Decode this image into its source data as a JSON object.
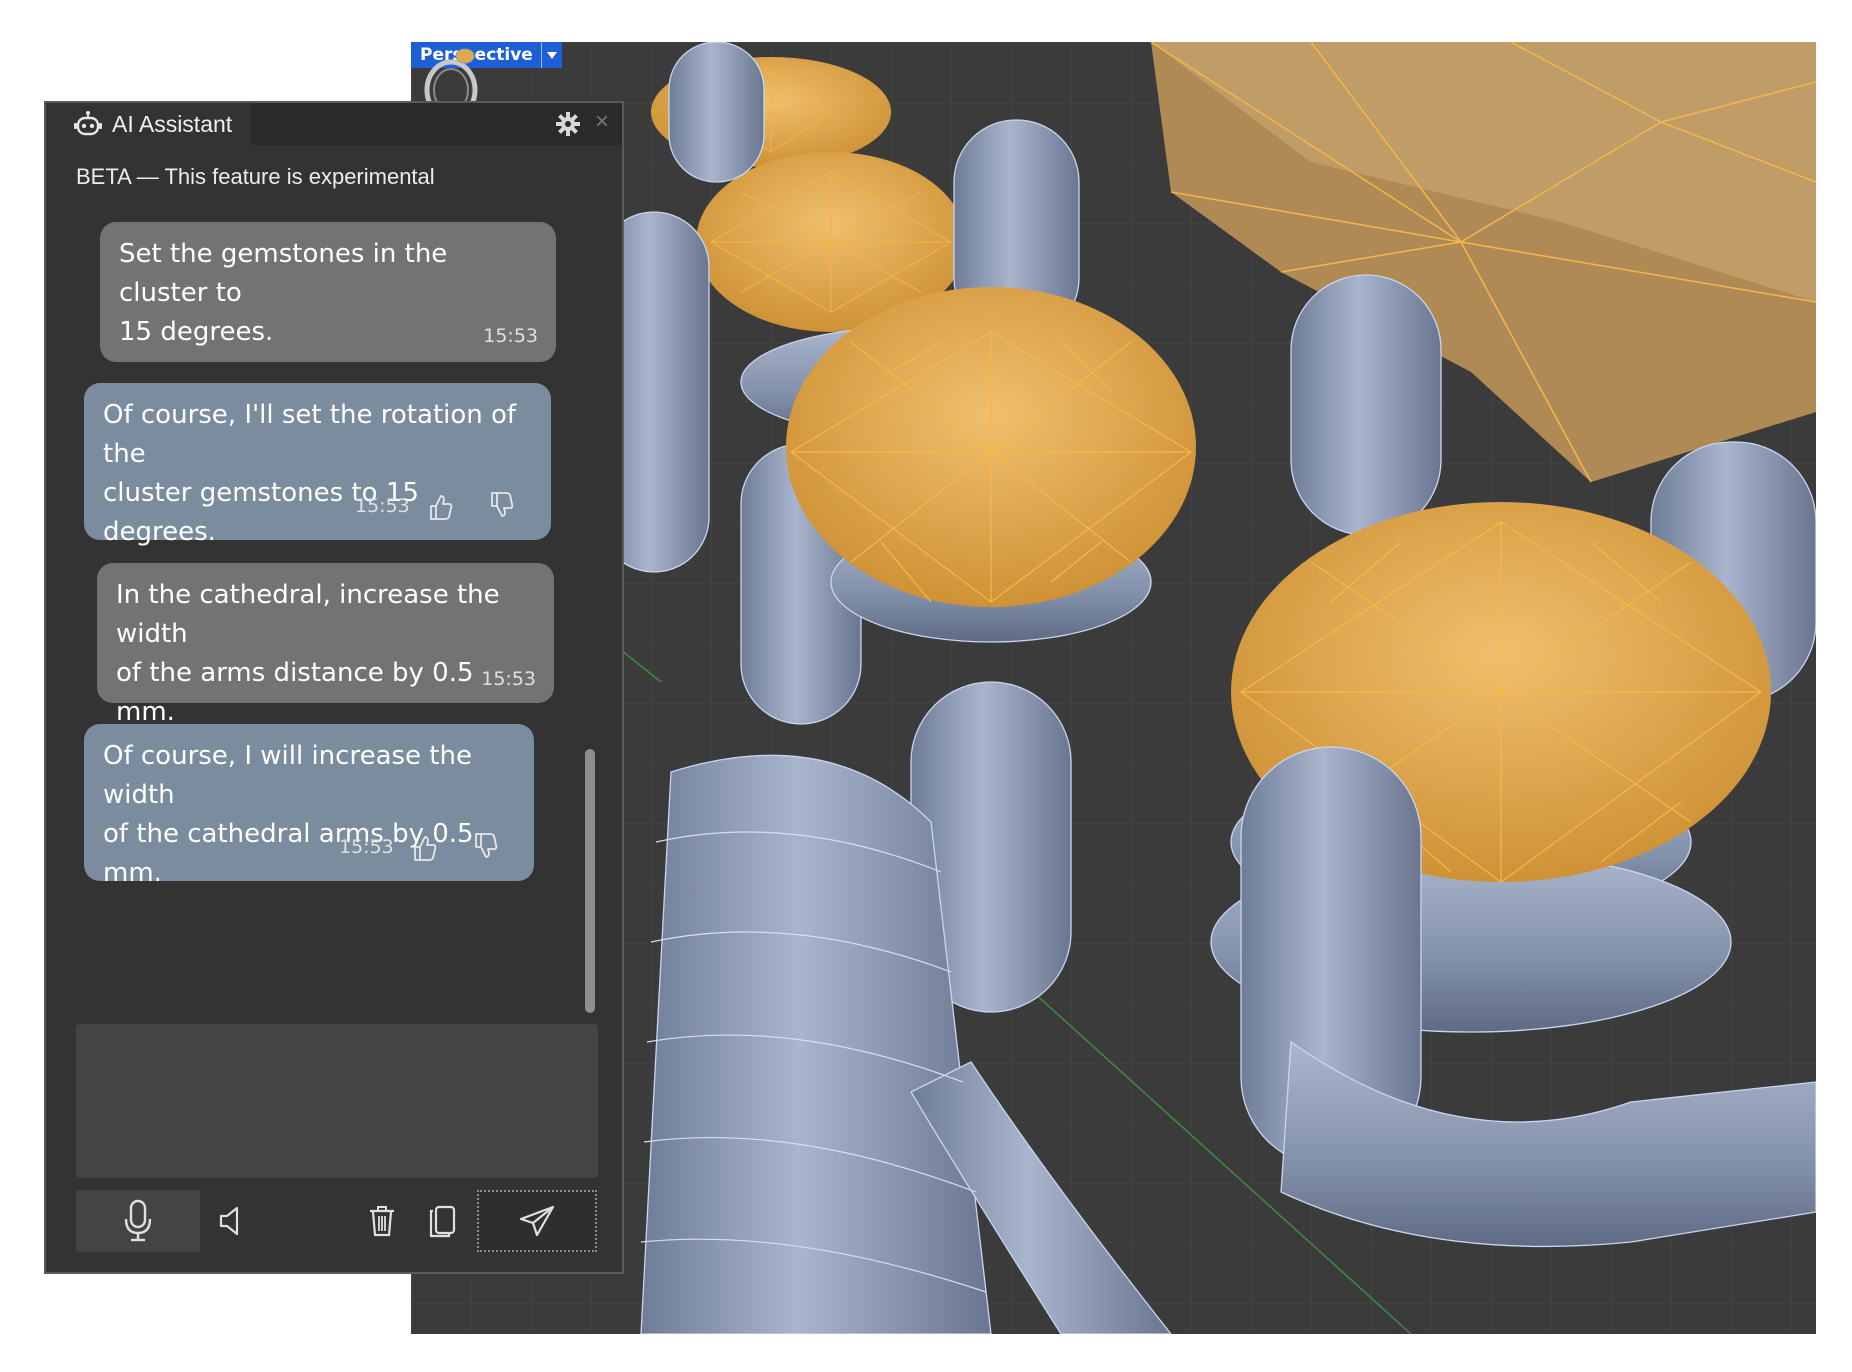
{
  "viewport": {
    "label": "Perspective",
    "dropdown_icon": "triangle-down-icon",
    "thumbnail_icon": "ring-thumbnail-icon"
  },
  "panel": {
    "title": "AI Assistant",
    "title_icon": "robot-icon",
    "settings_icon": "gear-icon",
    "close_icon": "close-icon",
    "beta_notice": "BETA — This feature is experimental",
    "messages": [
      {
        "role": "user",
        "lines": [
          "Set the gemstones in the cluster to",
          "15 degrees."
        ],
        "time": "15:53"
      },
      {
        "role": "assistant",
        "lines": [
          "Of course, I'll set the rotation of the",
          "cluster gemstones to 15 degrees."
        ],
        "time": "15:53"
      },
      {
        "role": "user",
        "lines": [
          "In the cathedral, increase the width",
          "of the arms distance by 0.5 mm."
        ],
        "time": "15:53"
      },
      {
        "role": "assistant",
        "lines": [
          "Of course, I will increase the width",
          "of the cathedral arms by 0.5 mm."
        ],
        "time": "15:53"
      }
    ],
    "input": {
      "value": ""
    },
    "toolbar": {
      "mic_icon": "microphone-icon",
      "speaker_icon": "speaker-icon",
      "delete_icon": "trash-icon",
      "copy_icon": "copy-icon",
      "send_icon": "send-icon"
    }
  },
  "colors": {
    "panel_bg": "#333333",
    "user_bubble": "#737373",
    "assistant_bubble": "#7a8c9e",
    "gem": "#e8a94c",
    "metal": "#8e9bb5",
    "viewport_bg": "#3b3b3b",
    "view_label": "#1f5fd6"
  }
}
